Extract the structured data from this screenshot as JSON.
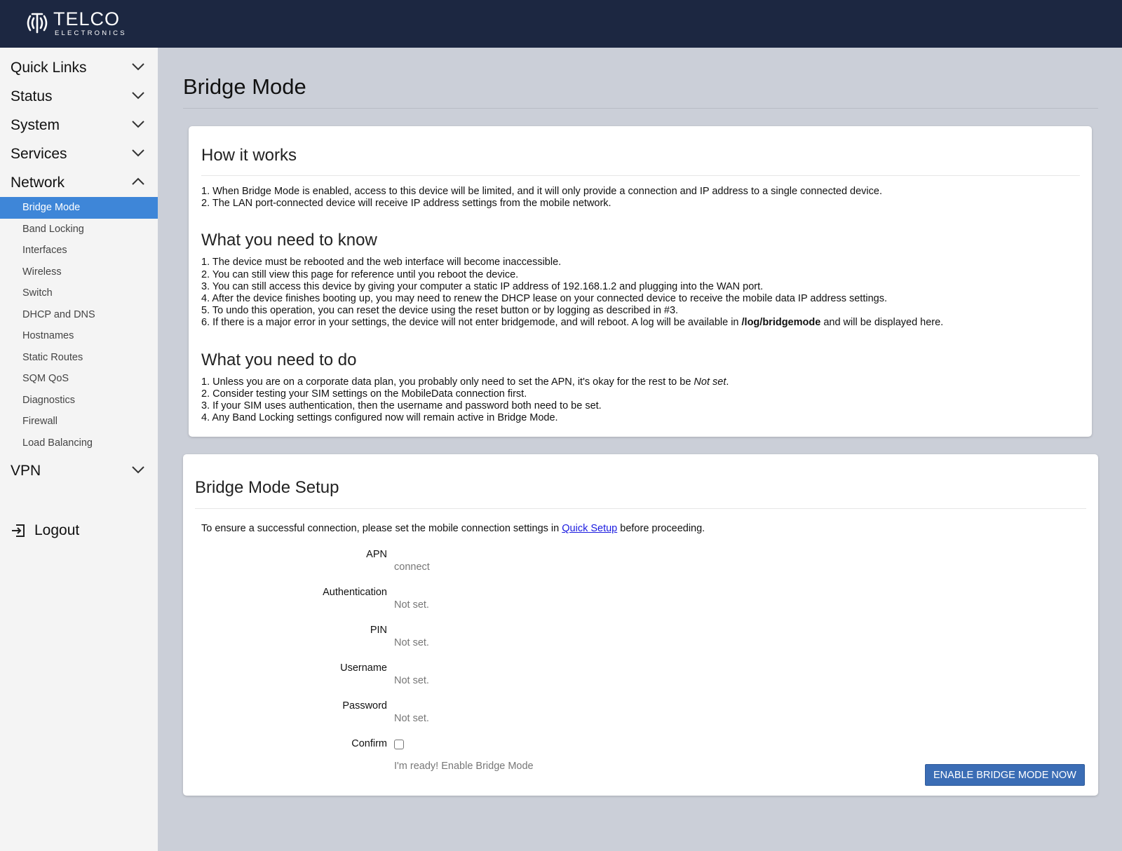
{
  "brand": {
    "name": "TELCO",
    "tagline": "ELECTRONICS"
  },
  "sidebar": {
    "sections": [
      {
        "label": "Quick Links",
        "expanded": false
      },
      {
        "label": "Status",
        "expanded": false
      },
      {
        "label": "System",
        "expanded": false
      },
      {
        "label": "Services",
        "expanded": false
      },
      {
        "label": "Network",
        "expanded": true
      }
    ],
    "network_items": [
      {
        "label": "Bridge Mode",
        "active": true
      },
      {
        "label": "Band Locking"
      },
      {
        "label": "Interfaces"
      },
      {
        "label": "Wireless"
      },
      {
        "label": "Switch"
      },
      {
        "label": "DHCP and DNS"
      },
      {
        "label": "Hostnames"
      },
      {
        "label": "Static Routes"
      },
      {
        "label": "SQM QoS"
      },
      {
        "label": "Diagnostics"
      },
      {
        "label": "Firewall"
      },
      {
        "label": "Load Balancing"
      }
    ],
    "vpn": {
      "label": "VPN",
      "expanded": false
    },
    "logout": "Logout"
  },
  "page": {
    "title": "Bridge Mode",
    "how_it_works": {
      "heading": "How it works",
      "items": [
        "1. When Bridge Mode is enabled, access to this device will be limited, and it will only provide a connection and IP address to a single connected device.",
        "2. The LAN port-connected device will receive IP address settings from the mobile network."
      ]
    },
    "need_to_know": {
      "heading": "What you need to know",
      "items": [
        "1. The device must be rebooted and the web interface will become inaccessible.",
        "2. You can still view this page for reference until you reboot the device.",
        "3. You can still access this device by giving your computer a static IP address of 192.168.1.2 and plugging into the WAN port.",
        "4. After the device finishes booting up, you may need to renew the DHCP lease on your connected device to receive the mobile data IP address settings.",
        "5. To undo this operation, you can reset the device using the reset button or by logging as described in #3."
      ],
      "item6_prefix": "6. If there is a major error in your settings, the device will not enter bridgemode, and will reboot. A log will be available in ",
      "item6_path": "/log/bridgemode",
      "item6_suffix": " and will be displayed here."
    },
    "need_to_do": {
      "heading": "What you need to do",
      "item1_prefix": "1. Unless you are on a corporate data plan, you probably only need to set the APN, it's okay for the rest to be ",
      "item1_em": "Not set",
      "item1_suffix": ".",
      "items": [
        "2. Consider testing your SIM settings on the MobileData connection first.",
        "3. If your SIM uses authentication, then the username and password both need to be set.",
        "4. Any Band Locking settings configured now will remain active in Bridge Mode."
      ]
    },
    "setup": {
      "heading": "Bridge Mode Setup",
      "intro_prefix": "To ensure a successful connection, please set the mobile connection settings in ",
      "intro_link": "Quick Setup",
      "intro_suffix": " before proceeding.",
      "fields": [
        {
          "label": "APN",
          "value": "connect"
        },
        {
          "label": "Authentication",
          "value": "Not set."
        },
        {
          "label": "PIN",
          "value": "Not set."
        },
        {
          "label": "Username",
          "value": "Not set."
        },
        {
          "label": "Password",
          "value": "Not set."
        }
      ],
      "confirm": {
        "label": "Confirm",
        "checked": false,
        "description": "I'm ready! Enable Bridge Mode"
      }
    },
    "enable_button": "ENABLE BRIDGE MODE NOW"
  },
  "colors": {
    "header_bg": "#1c2741",
    "page_bg": "#cbcfd8",
    "sidebar_bg": "#f4f4f4",
    "active_item": "#3e86d8",
    "primary_button": "#3b6db5",
    "link": "#1a1ae0"
  }
}
